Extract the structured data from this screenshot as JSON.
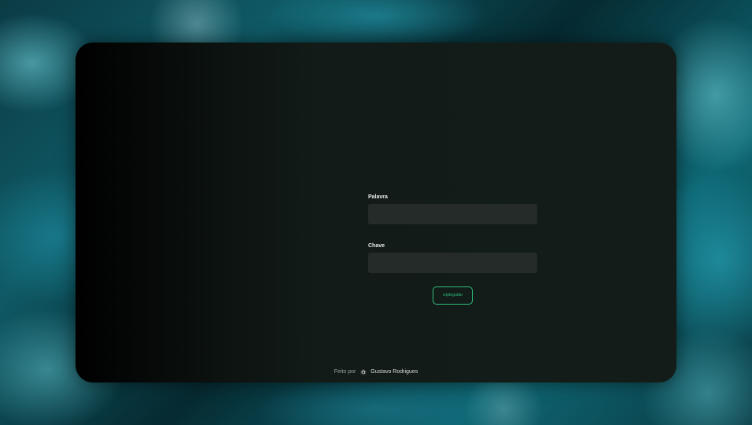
{
  "form": {
    "word_label": "Palavra",
    "word_value": "",
    "key_label": "Chave",
    "key_value": "",
    "submit_label": "criptografar"
  },
  "footer": {
    "prefix": "Feito por",
    "author": "Gustavo Rodrigues",
    "icon": "github-icon"
  },
  "colors": {
    "accent": "#2fbf7f",
    "card_background": "#131c18",
    "input_background": "#242b28"
  }
}
